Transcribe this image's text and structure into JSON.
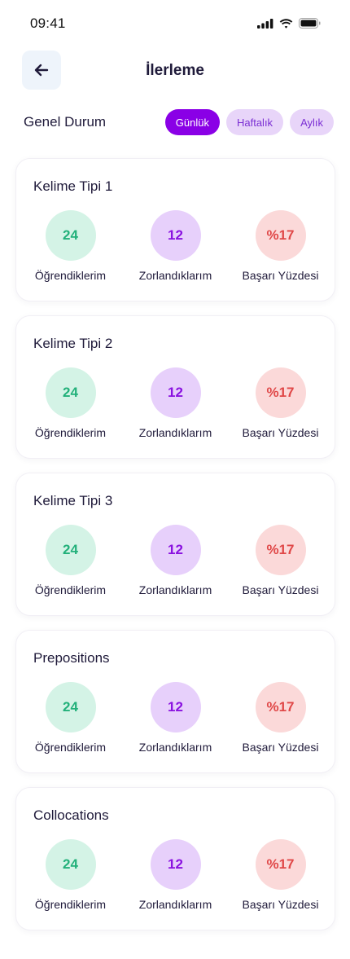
{
  "status_bar": {
    "time": "09:41"
  },
  "header": {
    "title": "İlerleme"
  },
  "overview": {
    "title": "Genel Durum",
    "filters": [
      {
        "label": "Günlük",
        "active": true
      },
      {
        "label": "Haftalık",
        "active": false
      },
      {
        "label": "Aylık",
        "active": false
      }
    ]
  },
  "cards": [
    {
      "title": "Kelime Tipi 1",
      "learned": "24",
      "struggled": "12",
      "success": "%17",
      "learned_label": "Öğrendiklerim",
      "struggled_label": "Zorlandıklarım",
      "success_label": "Başarı Yüzdesi"
    },
    {
      "title": "Kelime Tipi 2",
      "learned": "24",
      "struggled": "12",
      "success": "%17",
      "learned_label": "Öğrendiklerim",
      "struggled_label": "Zorlandıklarım",
      "success_label": "Başarı Yüzdesi"
    },
    {
      "title": "Kelime Tipi 3",
      "learned": "24",
      "struggled": "12",
      "success": "%17",
      "learned_label": "Öğrendiklerim",
      "struggled_label": "Zorlandıklarım",
      "success_label": "Başarı Yüzdesi"
    },
    {
      "title": "Prepositions",
      "learned": "24",
      "struggled": "12",
      "success": "%17",
      "learned_label": "Öğrendiklerim",
      "struggled_label": "Zorlandıklarım",
      "success_label": "Başarı Yüzdesi"
    },
    {
      "title": "Collocations",
      "learned": "24",
      "struggled": "12",
      "success": "%17",
      "learned_label": "Öğrendiklerim",
      "struggled_label": "Zorlandıklarım",
      "success_label": "Başarı Yüzdesi"
    }
  ],
  "colors": {
    "accent": "#8a00e6",
    "learned": "#22b07a",
    "struggled": "#8a12e0",
    "success": "#e04848"
  },
  "icons": {
    "back": "arrow-left-icon",
    "signal": "cellular-signal-icon",
    "wifi": "wifi-icon",
    "battery": "battery-icon"
  }
}
